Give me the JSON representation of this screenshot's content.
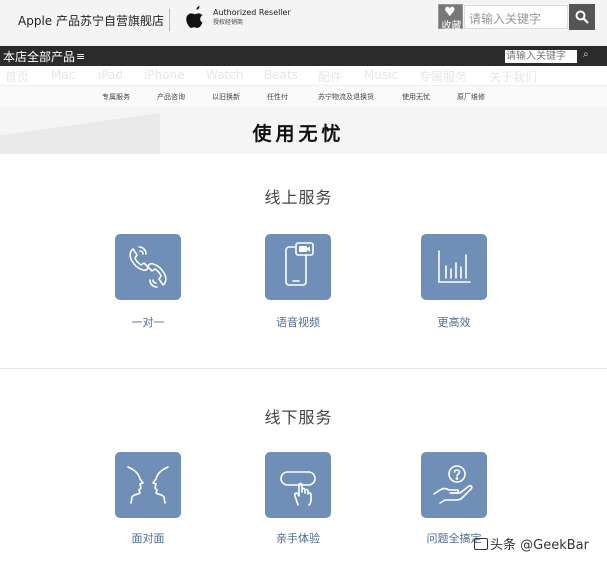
{
  "header": {
    "store_name": "Apple 产品苏宁自营旗舰店",
    "reseller_en": "Authorized Reseller",
    "reseller_cn": "授权经销商",
    "favorite_label": "收藏",
    "search_placeholder": "请输入关键字"
  },
  "darkbar": {
    "all_products": "本店全部产品",
    "menu_glyph": "≡",
    "search_placeholder": "请输入关键字",
    "search_glyph": "⌕"
  },
  "nav": {
    "items": [
      "首页",
      "Mac",
      "iPad",
      "iPhone",
      "Watch",
      "Beats",
      "配件",
      "Music",
      "专属服务",
      "关于我们"
    ]
  },
  "subnav": {
    "items": [
      "专属服务",
      "产品咨询",
      "以旧换新",
      "任性付",
      "苏宁物流及退换货",
      "使用无忧",
      "原厂维修"
    ]
  },
  "banner": {
    "title": "使用无忧"
  },
  "online": {
    "title": "线上服务",
    "items": [
      {
        "label": "一对一",
        "icon": "phone-calls-icon"
      },
      {
        "label": "语音视频",
        "icon": "video-call-icon"
      },
      {
        "label": "更高效",
        "icon": "bar-chart-icon"
      }
    ]
  },
  "offline": {
    "title": "线下服务",
    "items": [
      {
        "label": "面对面",
        "icon": "face-to-face-icon"
      },
      {
        "label": "亲手体验",
        "icon": "hand-touch-icon"
      },
      {
        "label": "问题全搞定",
        "icon": "question-hand-icon"
      }
    ]
  },
  "watermark": "头条 @GeekBar",
  "colors": {
    "accent": "#6f8fb6",
    "label": "#4d6d95",
    "darkbar": "#2b2b2b"
  }
}
